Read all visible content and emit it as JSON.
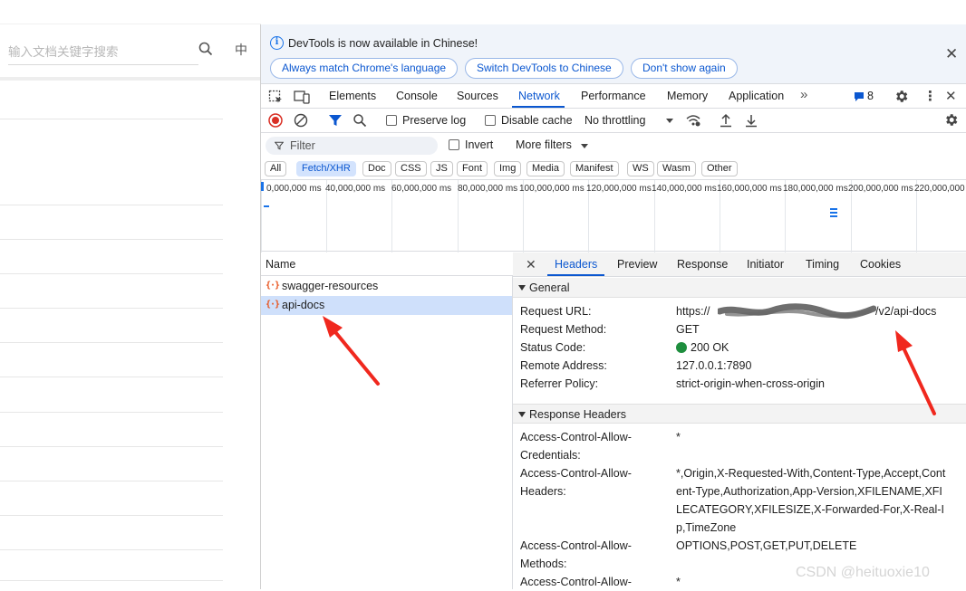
{
  "left_page": {
    "search_placeholder": "输入文档关键字搜索",
    "lang_label": "中"
  },
  "infobar": {
    "message": "DevTools is now available in Chinese!",
    "buttons": [
      "Always match Chrome's language",
      "Switch DevTools to Chinese",
      "Don't show again"
    ]
  },
  "tabs": {
    "items": [
      "Elements",
      "Console",
      "Sources",
      "Network",
      "Performance",
      "Memory",
      "Application"
    ],
    "active": "Network",
    "more": "»",
    "issues_count": "8"
  },
  "toolbar": {
    "preserve_log": "Preserve log",
    "disable_cache": "Disable cache",
    "throttling": "No throttling"
  },
  "filterbar": {
    "filter_placeholder": "Filter",
    "invert": "Invert",
    "more_filters": "More filters"
  },
  "type_filters": {
    "items": [
      "All",
      "Fetch/XHR",
      "Doc",
      "CSS",
      "JS",
      "Font",
      "Img",
      "Media",
      "Manifest",
      "WS",
      "Wasm",
      "Other"
    ],
    "active": "Fetch/XHR"
  },
  "overview": {
    "ticks": [
      "0,000,000 ms",
      "40,000,000 ms",
      "60,000,000 ms",
      "80,000,000 ms",
      "100,000,000 ms",
      "120,000,000 ms",
      "140,000,000 ms",
      "160,000,000 ms",
      "180,000,000 ms",
      "200,000,000 ms",
      "220,000,000"
    ]
  },
  "requests": {
    "header": "Name",
    "items": [
      {
        "name": "swagger-resources",
        "selected": false
      },
      {
        "name": "api-docs",
        "selected": true
      }
    ]
  },
  "details": {
    "tabs": [
      "Headers",
      "Preview",
      "Response",
      "Initiator",
      "Timing",
      "Cookies"
    ],
    "active_tab": "Headers",
    "general_title": "General",
    "general": {
      "request_url_key": "Request URL:",
      "request_url_value_start": "https://",
      "request_url_value_end": "/v2/api-docs",
      "request_method_key": "Request Method:",
      "request_method_value": "GET",
      "status_code_key": "Status Code:",
      "status_code_value": "200 OK",
      "remote_address_key": "Remote Address:",
      "remote_address_value": "127.0.0.1:7890",
      "referrer_policy_key": "Referrer Policy:",
      "referrer_policy_value": "strict-origin-when-cross-origin"
    },
    "response_headers_title": "Response Headers",
    "response_headers": [
      {
        "key": "Access-Control-Allow-Credentials:",
        "value": "*"
      },
      {
        "key": "Access-Control-Allow-Headers:",
        "value": "*,Origin,X-Requested-With,Content-Type,Accept,Content-Type,Authorization,App-Version,XFILENAME,XFILECATEGORY,XFILESIZE,X-Forwarded-For,X-Real-Ip,TimeZone"
      },
      {
        "key": "Access-Control-Allow-Methods:",
        "value": "OPTIONS,POST,GET,PUT,DELETE"
      },
      {
        "key": "Access-Control-Allow-",
        "value": "*"
      }
    ]
  },
  "watermark": "CSDN @heituoxie10",
  "colors": {
    "accent": "#0b57d0",
    "arrow": "#f0281e",
    "selected_row": "#cfe0fb"
  }
}
